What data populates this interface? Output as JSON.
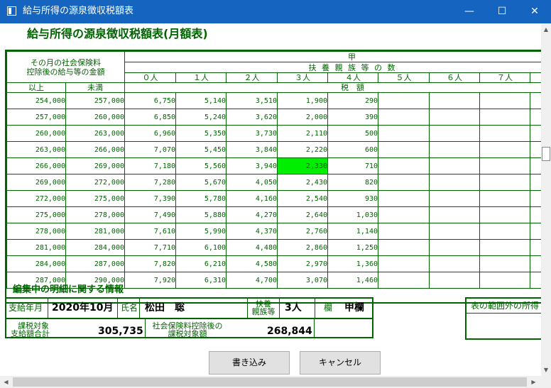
{
  "window": {
    "title": "給与所得の源泉徴収税額表",
    "minimize_icon": "minimize-icon",
    "maximize_icon": "maximize-icon",
    "close_icon": "close-icon",
    "minimize_glyph": "—",
    "maximize_glyph": "☐",
    "close_glyph": "✕"
  },
  "page_title": "給与所得の源泉徴収税額表(月額表)",
  "table": {
    "header_income_label_1": "その月の社会保険料",
    "header_income_label_2": "控除後の給与等の金額",
    "header_kou": "甲",
    "header_dependents": "扶 養 親 族 等 の 数",
    "dependent_columns": [
      "０人",
      "１人",
      "２人",
      "３人",
      "４人",
      "５人",
      "６人",
      "７人"
    ],
    "col_from": "以上",
    "col_to": "未満",
    "tax_label": "税　額",
    "rows": [
      {
        "from": "254,000",
        "to": "257,000",
        "taxes": [
          "6,750",
          "5,140",
          "3,510",
          "1,900",
          "290",
          "",
          "",
          ""
        ]
      },
      {
        "from": "257,000",
        "to": "260,000",
        "taxes": [
          "6,850",
          "5,240",
          "3,620",
          "2,000",
          "390",
          "",
          "",
          ""
        ]
      },
      {
        "from": "260,000",
        "to": "263,000",
        "taxes": [
          "6,960",
          "5,350",
          "3,730",
          "2,110",
          "500",
          "",
          "",
          ""
        ]
      },
      {
        "from": "263,000",
        "to": "266,000",
        "taxes": [
          "7,070",
          "5,450",
          "3,840",
          "2,220",
          "600",
          "",
          "",
          ""
        ]
      },
      {
        "from": "266,000",
        "to": "269,000",
        "taxes": [
          "7,180",
          "5,560",
          "3,940",
          "2,330",
          "710",
          "",
          "",
          ""
        ]
      },
      {
        "from": "269,000",
        "to": "272,000",
        "taxes": [
          "7,280",
          "5,670",
          "4,050",
          "2,430",
          "820",
          "",
          "",
          ""
        ]
      },
      {
        "from": "272,000",
        "to": "275,000",
        "taxes": [
          "7,390",
          "5,780",
          "4,160",
          "2,540",
          "930",
          "",
          "",
          ""
        ]
      },
      {
        "from": "275,000",
        "to": "278,000",
        "taxes": [
          "7,490",
          "5,880",
          "4,270",
          "2,640",
          "1,030",
          "",
          "",
          ""
        ]
      },
      {
        "from": "278,000",
        "to": "281,000",
        "taxes": [
          "7,610",
          "5,990",
          "4,370",
          "2,760",
          "1,140",
          "",
          "",
          ""
        ]
      },
      {
        "from": "281,000",
        "to": "284,000",
        "taxes": [
          "7,710",
          "6,100",
          "4,480",
          "2,860",
          "1,250",
          "",
          "",
          ""
        ]
      },
      {
        "from": "284,000",
        "to": "287,000",
        "taxes": [
          "7,820",
          "6,210",
          "4,580",
          "2,970",
          "1,360",
          "",
          "",
          ""
        ]
      },
      {
        "from": "287,000",
        "to": "290,000",
        "taxes": [
          "7,920",
          "6,310",
          "4,700",
          "3,070",
          "1,460",
          "",
          "",
          ""
        ]
      }
    ],
    "highlight_color": "#00ee00"
  },
  "details": {
    "section_title": "編集中の明細に関する情報",
    "pay_month_label": "支給年月",
    "pay_month_value": "2020年10月",
    "name_label": "氏名",
    "name_value": "松田　聡",
    "dependents_label_1": "扶養",
    "dependents_label_2": "親族等",
    "dependents_value": "3人",
    "column_label": "欄",
    "column_value": "甲欄",
    "taxable_pay_label_1": "課税対象",
    "taxable_pay_label_2": "支給額合計",
    "taxable_pay_value": "305,735",
    "after_si_label_1": "社会保険料控除後の",
    "after_si_label_2": "課税対象額",
    "after_si_value": "268,844",
    "out_of_range_label": "表の範囲外の所得"
  },
  "buttons": {
    "write": "書き込み",
    "cancel": "キャンセル"
  },
  "colors": {
    "titlebar": "#1565c0",
    "accent_green": "#006400",
    "highlight": "#00ee00"
  }
}
